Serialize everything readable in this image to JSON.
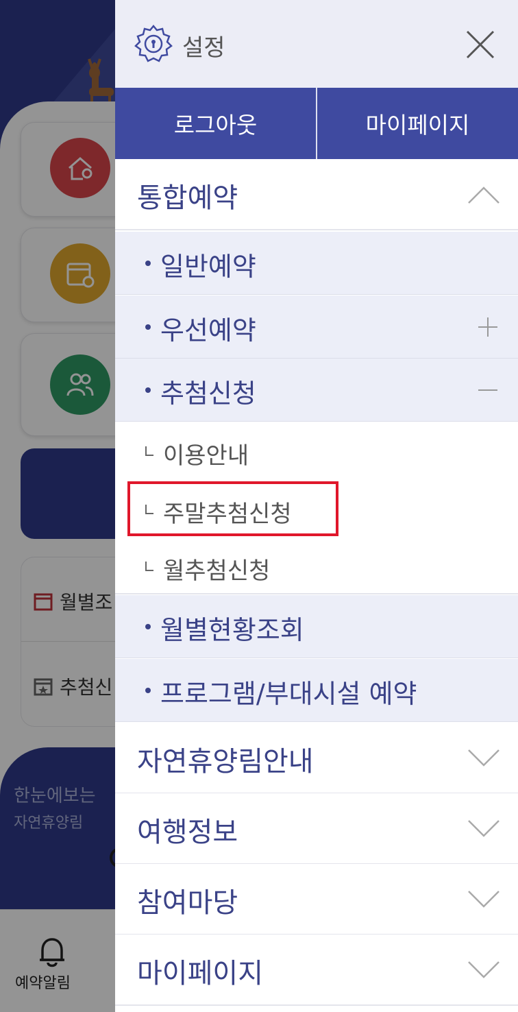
{
  "background": {
    "list_items": [
      "월별조",
      "추첨신"
    ],
    "bottom_card_title": "한눈에보는",
    "bottom_card_subtitle": "자연휴양림",
    "tabbar_item": "예약알림",
    "colors": {
      "circle1": "#d9454a",
      "circle2": "#e0a82e",
      "circle3": "#2f9a64",
      "navy": "#2f3a8a"
    }
  },
  "drawer": {
    "title": "설정",
    "logout_label": "로그아웃",
    "mypage_label": "마이페이지",
    "menu": {
      "integrated_reservation": "통합예약",
      "general_reservation": "일반예약",
      "priority_reservation": "우선예약",
      "lottery_application": "추첨신청",
      "usage_guide": "이용안내",
      "weekend_lottery": "주말추첨신청",
      "monthly_lottery": "월추첨신청",
      "monthly_status": "월별현황조회",
      "program_facility": "프로그램/부대시설 예약",
      "forest_guide": "자연휴양림안내",
      "travel_info": "여행정보",
      "community": "참여마당",
      "my_page": "마이페이지"
    },
    "colors": {
      "accent": "#3f4aa0",
      "text": "#3a4287",
      "highlight": "#e0172b"
    }
  }
}
